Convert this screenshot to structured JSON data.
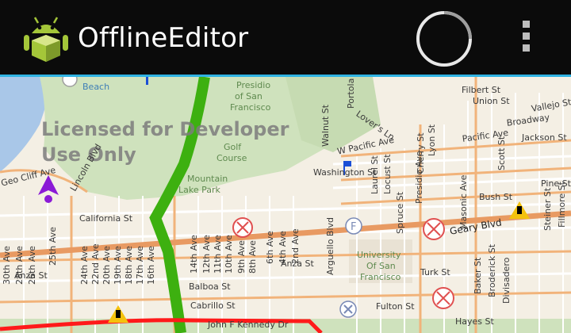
{
  "app": {
    "title": "OfflineEditor"
  },
  "colors": {
    "action_bar": "#0b0b0b",
    "accent": "#2fb3e3",
    "route_green": "#3db010",
    "route_red": "#ff1a1a"
  },
  "map": {
    "watermark_line1": "Licensed for Developer",
    "watermark_line2": "Use Only",
    "labels": {
      "beach": "Beach",
      "presidio": "Presidio",
      "of": "of San",
      "francisco": "Francisco",
      "golf": "Golf",
      "course": "Course",
      "mountain": "Mountain",
      "lake_park": "Lake Park",
      "lovers": "Lover's Ln",
      "wpacific": "W Pacific Ave",
      "washington": "Washington St",
      "filbert": "Filbert St",
      "union": "Union St",
      "vallejo": "Vallejo St",
      "broadway": "Broadway",
      "pacific": "Pacific Ave",
      "jackson": "Jackson St",
      "bush": "Bush St",
      "pine": "Pine St",
      "california": "California St",
      "geary": "Geary Blvd",
      "anza1": "Anza St",
      "anza2": "Anza St",
      "turk": "Turk St",
      "fulton": "Fulton St",
      "hayes": "Hayes St",
      "balboa": "Balboa St",
      "cabrillo": "Cabrillo St",
      "jfk": "John F Kennedy Dr",
      "university": "University",
      "of_sf": "Of San",
      "francisco2": "Francisco",
      "cliff": "Geo Cliff Ave",
      "lincoln": "Lincoln Blvd",
      "ave25": "25th Ave",
      "ave30": "30th Ave",
      "ave28": "28th Ave",
      "ave26": "26th Ave",
      "ave24": "24th Ave",
      "ave22": "22nd Ave",
      "ave20": "20th Ave",
      "ave19": "19th Ave",
      "ave18": "18th Ave",
      "ave17": "17th Ave",
      "ave16": "16th Ave",
      "ave14": "14th Ave",
      "ave12": "12th Ave",
      "ave11": "11th Ave",
      "ave10": "10th Ave",
      "ave9": "9th Ave",
      "ave8": "8th Ave",
      "ave6": "6th Ave",
      "ave4": "4th Ave",
      "ave2": "2nd Ave",
      "arguello": "Arguello Blvd",
      "presidio_ave": "Presidio Ave",
      "lyon": "Lyon St",
      "laurel": "Laurel St",
      "locust": "Locust St",
      "spruce": "Spruce St",
      "cherry": "Cherry St",
      "baker": "Baker St",
      "broderick": "Broderick St",
      "divisadero": "Divisadero",
      "scott": "Scott St",
      "fillmore": "Fillmore St",
      "steiner": "Steiner St",
      "masonic": "Masonic Ave",
      "walnut": "Walnut St",
      "portola": "Portola St"
    }
  }
}
